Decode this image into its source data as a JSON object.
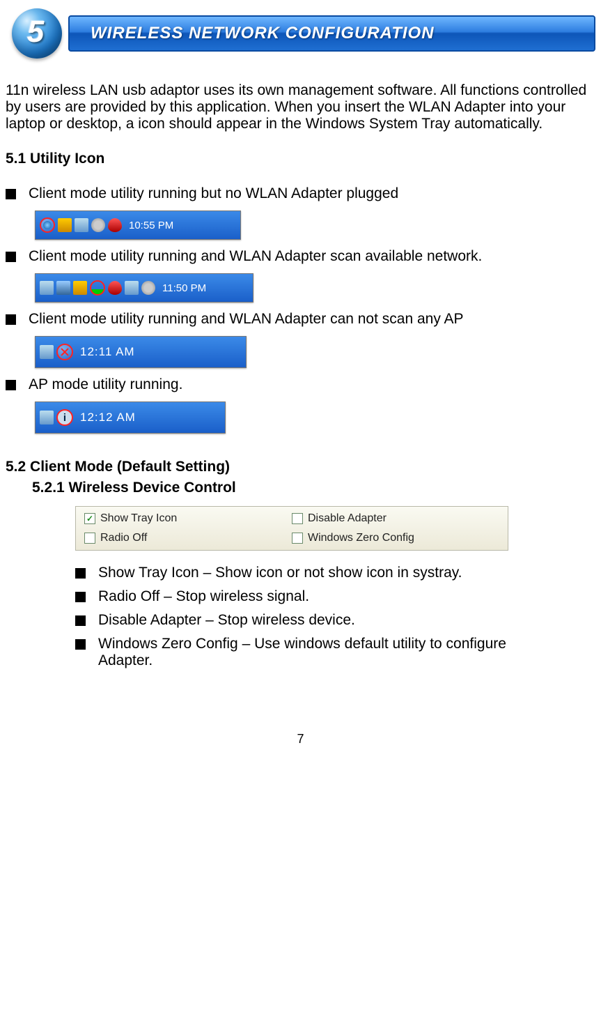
{
  "chapter": {
    "number": "5",
    "title": "WIRELESS NETWORK CONFIGURATION"
  },
  "intro": "11n wireless LAN usb adaptor uses its own management software. All functions controlled by users are provided by this application. When you insert the WLAN Adapter into your laptop or desktop, a icon should appear in the Windows System Tray automatically.",
  "section51": {
    "heading": "5.1 Utility Icon",
    "items": [
      {
        "text": "Client mode utility running but no WLAN Adapter plugged",
        "time": "10:55 PM"
      },
      {
        "text": "Client mode utility running and WLAN Adapter scan available network.",
        "time": "11:50 PM"
      },
      {
        "text": "Client mode utility running and WLAN Adapter can not scan any AP",
        "time": "12:11 AM"
      },
      {
        "text": "AP mode utility running.",
        "time": "12:12 AM"
      }
    ]
  },
  "section52": {
    "heading": "5.2 Client Mode (Default Setting)",
    "sub": "5.2.1 Wireless Device Control",
    "checkboxes": {
      "show_tray": {
        "label": "Show Tray Icon",
        "checked": true
      },
      "disable_adapter": {
        "label": "Disable Adapter",
        "checked": false
      },
      "radio_off": {
        "label": "Radio Off",
        "checked": false
      },
      "win_zero": {
        "label": "Windows Zero Config",
        "checked": false
      }
    },
    "descriptions": [
      "Show Tray Icon – Show icon or not show icon in systray.",
      "Radio Off – Stop wireless signal.",
      "Disable Adapter – Stop wireless device.",
      "Windows Zero Config – Use windows default utility to configure Adapter."
    ]
  },
  "page_number": "7"
}
